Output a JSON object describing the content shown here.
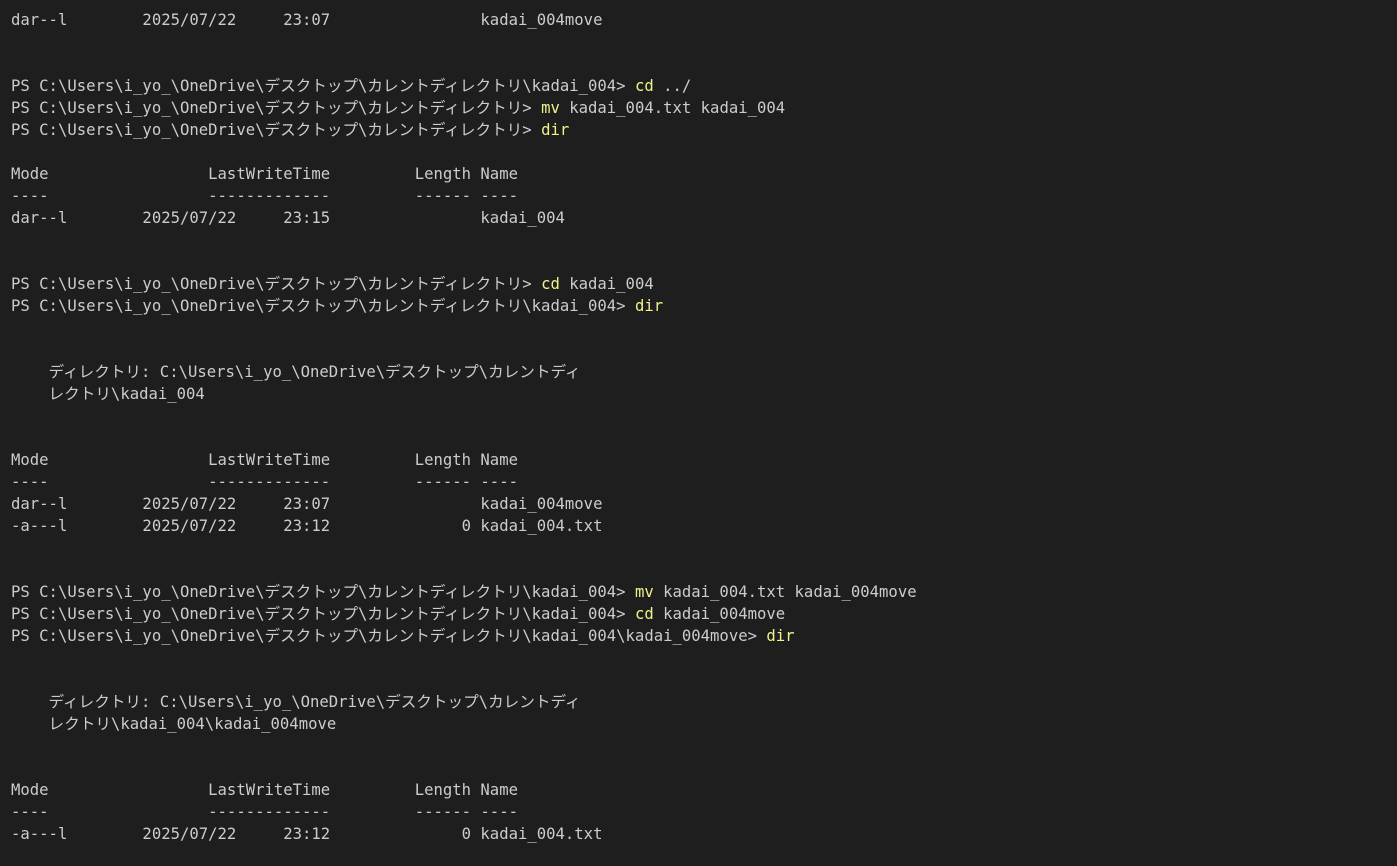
{
  "terminal": {
    "lines": [
      {
        "type": "text",
        "text": "dar--l        2025/07/22     23:07                kadai_004move"
      },
      {
        "type": "blank"
      },
      {
        "type": "blank"
      },
      {
        "type": "prompt",
        "prompt": "PS C:\\Users\\i_yo_\\OneDrive\\デスクトップ\\カレントディレクトリ\\kadai_004> ",
        "command": "cd",
        "args": " ../"
      },
      {
        "type": "prompt",
        "prompt": "PS C:\\Users\\i_yo_\\OneDrive\\デスクトップ\\カレントディレクトリ> ",
        "command": "mv",
        "args": " kadai_004.txt kadai_004"
      },
      {
        "type": "prompt",
        "prompt": "PS C:\\Users\\i_yo_\\OneDrive\\デスクトップ\\カレントディレクトリ> ",
        "command": "dir",
        "args": ""
      },
      {
        "type": "blank"
      },
      {
        "type": "text",
        "text": "Mode                 LastWriteTime         Length Name"
      },
      {
        "type": "text",
        "text": "----                 -------------         ------ ----"
      },
      {
        "type": "text",
        "text": "dar--l        2025/07/22     23:15                kadai_004"
      },
      {
        "type": "blank"
      },
      {
        "type": "blank"
      },
      {
        "type": "prompt",
        "prompt": "PS C:\\Users\\i_yo_\\OneDrive\\デスクトップ\\カレントディレクトリ> ",
        "command": "cd",
        "args": " kadai_004"
      },
      {
        "type": "prompt",
        "prompt": "PS C:\\Users\\i_yo_\\OneDrive\\デスクトップ\\カレントディレクトリ\\kadai_004> ",
        "command": "dir",
        "args": ""
      },
      {
        "type": "blank"
      },
      {
        "type": "blank"
      },
      {
        "type": "text",
        "text": "    ディレクトリ: C:\\Users\\i_yo_\\OneDrive\\デスクトップ\\カレントディ"
      },
      {
        "type": "text",
        "text": "    レクトリ\\kadai_004"
      },
      {
        "type": "blank"
      },
      {
        "type": "blank"
      },
      {
        "type": "text",
        "text": "Mode                 LastWriteTime         Length Name"
      },
      {
        "type": "text",
        "text": "----                 -------------         ------ ----"
      },
      {
        "type": "text",
        "text": "dar--l        2025/07/22     23:07                kadai_004move"
      },
      {
        "type": "text",
        "text": "-a---l        2025/07/22     23:12              0 kadai_004.txt"
      },
      {
        "type": "blank"
      },
      {
        "type": "blank"
      },
      {
        "type": "prompt",
        "prompt": "PS C:\\Users\\i_yo_\\OneDrive\\デスクトップ\\カレントディレクトリ\\kadai_004> ",
        "command": "mv",
        "args": " kadai_004.txt kadai_004move"
      },
      {
        "type": "prompt",
        "prompt": "PS C:\\Users\\i_yo_\\OneDrive\\デスクトップ\\カレントディレクトリ\\kadai_004> ",
        "command": "cd",
        "args": " kadai_004move"
      },
      {
        "type": "prompt",
        "prompt": "PS C:\\Users\\i_yo_\\OneDrive\\デスクトップ\\カレントディレクトリ\\kadai_004\\kadai_004move> ",
        "command": "dir",
        "args": ""
      },
      {
        "type": "blank"
      },
      {
        "type": "blank"
      },
      {
        "type": "text",
        "text": "    ディレクトリ: C:\\Users\\i_yo_\\OneDrive\\デスクトップ\\カレントディ"
      },
      {
        "type": "text",
        "text": "    レクトリ\\kadai_004\\kadai_004move"
      },
      {
        "type": "blank"
      },
      {
        "type": "blank"
      },
      {
        "type": "text",
        "text": "Mode                 LastWriteTime         Length Name"
      },
      {
        "type": "text",
        "text": "----                 -------------         ------ ----"
      },
      {
        "type": "text",
        "text": "-a---l        2025/07/22     23:12              0 kadai_004.txt"
      }
    ]
  },
  "colors": {
    "background": "#1e1e1e",
    "text": "#cccccc",
    "command": "#f2f28c"
  }
}
